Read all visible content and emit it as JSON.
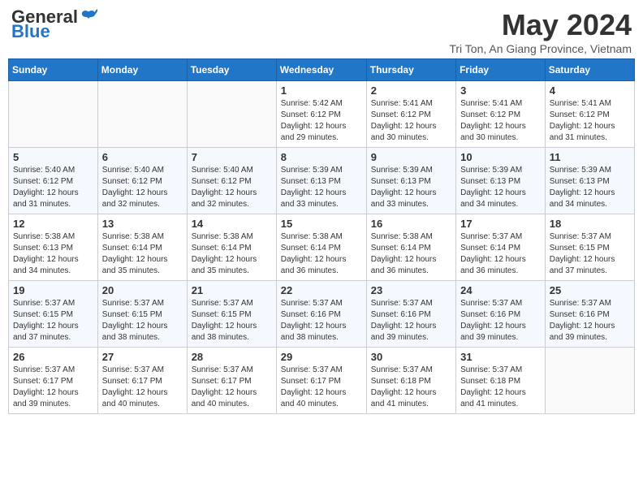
{
  "logo": {
    "general": "General",
    "blue": "Blue"
  },
  "title": "May 2024",
  "location": "Tri Ton, An Giang Province, Vietnam",
  "weekdays": [
    "Sunday",
    "Monday",
    "Tuesday",
    "Wednesday",
    "Thursday",
    "Friday",
    "Saturday"
  ],
  "weeks": [
    [
      {
        "day": "",
        "sunrise": "",
        "sunset": "",
        "daylight": ""
      },
      {
        "day": "",
        "sunrise": "",
        "sunset": "",
        "daylight": ""
      },
      {
        "day": "",
        "sunrise": "",
        "sunset": "",
        "daylight": ""
      },
      {
        "day": "1",
        "sunrise": "Sunrise: 5:42 AM",
        "sunset": "Sunset: 6:12 PM",
        "daylight": "Daylight: 12 hours and 29 minutes."
      },
      {
        "day": "2",
        "sunrise": "Sunrise: 5:41 AM",
        "sunset": "Sunset: 6:12 PM",
        "daylight": "Daylight: 12 hours and 30 minutes."
      },
      {
        "day": "3",
        "sunrise": "Sunrise: 5:41 AM",
        "sunset": "Sunset: 6:12 PM",
        "daylight": "Daylight: 12 hours and 30 minutes."
      },
      {
        "day": "4",
        "sunrise": "Sunrise: 5:41 AM",
        "sunset": "Sunset: 6:12 PM",
        "daylight": "Daylight: 12 hours and 31 minutes."
      }
    ],
    [
      {
        "day": "5",
        "sunrise": "Sunrise: 5:40 AM",
        "sunset": "Sunset: 6:12 PM",
        "daylight": "Daylight: 12 hours and 31 minutes."
      },
      {
        "day": "6",
        "sunrise": "Sunrise: 5:40 AM",
        "sunset": "Sunset: 6:12 PM",
        "daylight": "Daylight: 12 hours and 32 minutes."
      },
      {
        "day": "7",
        "sunrise": "Sunrise: 5:40 AM",
        "sunset": "Sunset: 6:12 PM",
        "daylight": "Daylight: 12 hours and 32 minutes."
      },
      {
        "day": "8",
        "sunrise": "Sunrise: 5:39 AM",
        "sunset": "Sunset: 6:13 PM",
        "daylight": "Daylight: 12 hours and 33 minutes."
      },
      {
        "day": "9",
        "sunrise": "Sunrise: 5:39 AM",
        "sunset": "Sunset: 6:13 PM",
        "daylight": "Daylight: 12 hours and 33 minutes."
      },
      {
        "day": "10",
        "sunrise": "Sunrise: 5:39 AM",
        "sunset": "Sunset: 6:13 PM",
        "daylight": "Daylight: 12 hours and 34 minutes."
      },
      {
        "day": "11",
        "sunrise": "Sunrise: 5:39 AM",
        "sunset": "Sunset: 6:13 PM",
        "daylight": "Daylight: 12 hours and 34 minutes."
      }
    ],
    [
      {
        "day": "12",
        "sunrise": "Sunrise: 5:38 AM",
        "sunset": "Sunset: 6:13 PM",
        "daylight": "Daylight: 12 hours and 34 minutes."
      },
      {
        "day": "13",
        "sunrise": "Sunrise: 5:38 AM",
        "sunset": "Sunset: 6:14 PM",
        "daylight": "Daylight: 12 hours and 35 minutes."
      },
      {
        "day": "14",
        "sunrise": "Sunrise: 5:38 AM",
        "sunset": "Sunset: 6:14 PM",
        "daylight": "Daylight: 12 hours and 35 minutes."
      },
      {
        "day": "15",
        "sunrise": "Sunrise: 5:38 AM",
        "sunset": "Sunset: 6:14 PM",
        "daylight": "Daylight: 12 hours and 36 minutes."
      },
      {
        "day": "16",
        "sunrise": "Sunrise: 5:38 AM",
        "sunset": "Sunset: 6:14 PM",
        "daylight": "Daylight: 12 hours and 36 minutes."
      },
      {
        "day": "17",
        "sunrise": "Sunrise: 5:37 AM",
        "sunset": "Sunset: 6:14 PM",
        "daylight": "Daylight: 12 hours and 36 minutes."
      },
      {
        "day": "18",
        "sunrise": "Sunrise: 5:37 AM",
        "sunset": "Sunset: 6:15 PM",
        "daylight": "Daylight: 12 hours and 37 minutes."
      }
    ],
    [
      {
        "day": "19",
        "sunrise": "Sunrise: 5:37 AM",
        "sunset": "Sunset: 6:15 PM",
        "daylight": "Daylight: 12 hours and 37 minutes."
      },
      {
        "day": "20",
        "sunrise": "Sunrise: 5:37 AM",
        "sunset": "Sunset: 6:15 PM",
        "daylight": "Daylight: 12 hours and 38 minutes."
      },
      {
        "day": "21",
        "sunrise": "Sunrise: 5:37 AM",
        "sunset": "Sunset: 6:15 PM",
        "daylight": "Daylight: 12 hours and 38 minutes."
      },
      {
        "day": "22",
        "sunrise": "Sunrise: 5:37 AM",
        "sunset": "Sunset: 6:16 PM",
        "daylight": "Daylight: 12 hours and 38 minutes."
      },
      {
        "day": "23",
        "sunrise": "Sunrise: 5:37 AM",
        "sunset": "Sunset: 6:16 PM",
        "daylight": "Daylight: 12 hours and 39 minutes."
      },
      {
        "day": "24",
        "sunrise": "Sunrise: 5:37 AM",
        "sunset": "Sunset: 6:16 PM",
        "daylight": "Daylight: 12 hours and 39 minutes."
      },
      {
        "day": "25",
        "sunrise": "Sunrise: 5:37 AM",
        "sunset": "Sunset: 6:16 PM",
        "daylight": "Daylight: 12 hours and 39 minutes."
      }
    ],
    [
      {
        "day": "26",
        "sunrise": "Sunrise: 5:37 AM",
        "sunset": "Sunset: 6:17 PM",
        "daylight": "Daylight: 12 hours and 39 minutes."
      },
      {
        "day": "27",
        "sunrise": "Sunrise: 5:37 AM",
        "sunset": "Sunset: 6:17 PM",
        "daylight": "Daylight: 12 hours and 40 minutes."
      },
      {
        "day": "28",
        "sunrise": "Sunrise: 5:37 AM",
        "sunset": "Sunset: 6:17 PM",
        "daylight": "Daylight: 12 hours and 40 minutes."
      },
      {
        "day": "29",
        "sunrise": "Sunrise: 5:37 AM",
        "sunset": "Sunset: 6:17 PM",
        "daylight": "Daylight: 12 hours and 40 minutes."
      },
      {
        "day": "30",
        "sunrise": "Sunrise: 5:37 AM",
        "sunset": "Sunset: 6:18 PM",
        "daylight": "Daylight: 12 hours and 41 minutes."
      },
      {
        "day": "31",
        "sunrise": "Sunrise: 5:37 AM",
        "sunset": "Sunset: 6:18 PM",
        "daylight": "Daylight: 12 hours and 41 minutes."
      },
      {
        "day": "",
        "sunrise": "",
        "sunset": "",
        "daylight": ""
      }
    ]
  ]
}
